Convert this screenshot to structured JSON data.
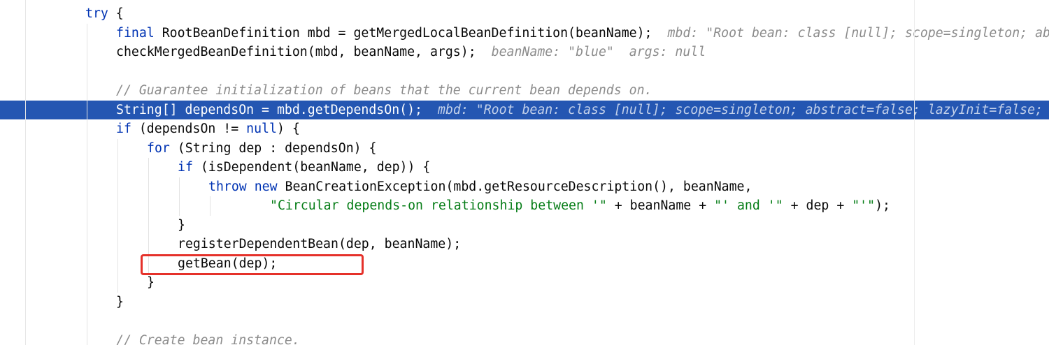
{
  "colors": {
    "keyword": "#0033b3",
    "string": "#067d17",
    "comment": "#8c8c8c",
    "hint": "#8c8c8c",
    "execution_line": "#2456b2",
    "annotation_box": "#e5312a"
  },
  "editor": {
    "lines": [
      {
        "tokens": [
          "try",
          " {"
        ]
      },
      {
        "tokens": [
          "final",
          " RootBeanDefinition mbd = getMergedLocalBeanDefinition(beanName);"
        ],
        "hint": "mbd: \"Root bean: class [null]; scope=singleton; ab"
      },
      {
        "tokens": [
          "checkMergedBeanDefinition(mbd, beanName, args);"
        ],
        "hint": "beanName: \"blue\"  args: null"
      },
      {},
      {
        "tokens": [
          "// Guarantee initialization of beans that the current bean depends on."
        ]
      },
      {
        "tokens": [
          "String[] dependsOn = mbd.getDependsOn();"
        ],
        "hint": "mbd: \"Root bean: class [null]; scope=singleton; abstract=false; lazyInit=false;"
      },
      {
        "tokens": [
          "if",
          " (dependsOn != ",
          "null",
          ") {"
        ]
      },
      {
        "tokens": [
          "for",
          " (String dep : dependsOn) {"
        ]
      },
      {
        "tokens": [
          "if",
          " (isDependent(beanName, dep)) {"
        ]
      },
      {
        "tokens": [
          "throw",
          " ",
          "new",
          " BeanCreationException(mbd.getResourceDescription(), beanName,"
        ]
      },
      {
        "tokens": [
          "\"Circular depends-on relationship between '\"",
          " + beanName + ",
          "\"' and '\"",
          " + dep + ",
          "\"'\"",
          ");"
        ]
      },
      {
        "tokens": [
          "}"
        ]
      },
      {
        "tokens": [
          "registerDependentBean(dep, beanName);"
        ]
      },
      {
        "tokens": [
          "getBean(dep);"
        ]
      },
      {
        "tokens": [
          "}"
        ]
      },
      {
        "tokens": [
          "}"
        ]
      },
      {},
      {
        "tokens": [
          "// Create bean instance."
        ]
      }
    ]
  }
}
